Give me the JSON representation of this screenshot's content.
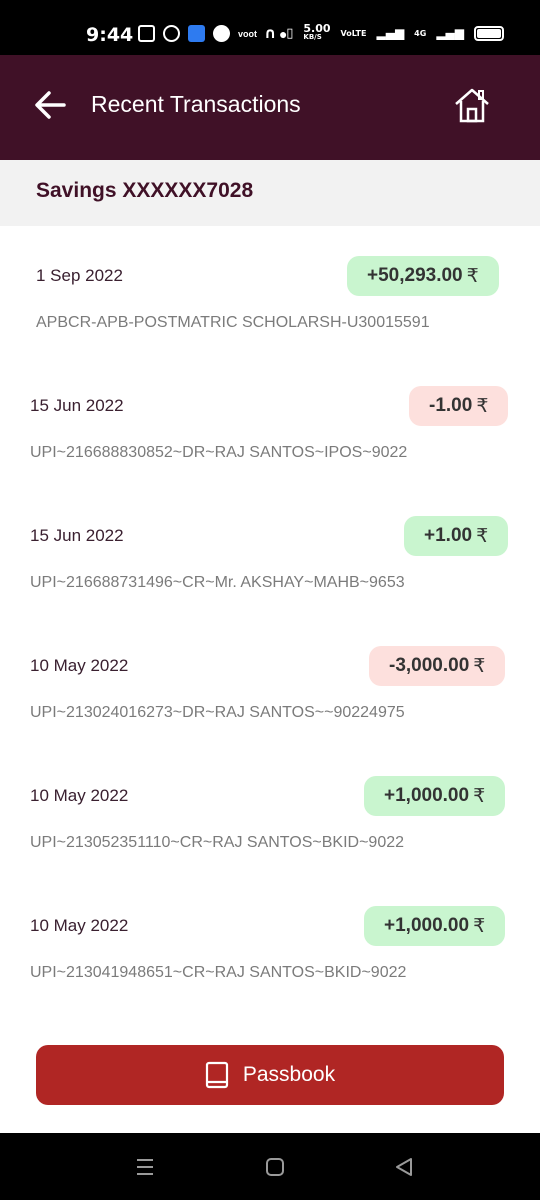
{
  "status_bar": {
    "time": "9:44",
    "speed": "5.00",
    "speed_unit": "KB/S",
    "volte": "VoLTE",
    "network": "4G"
  },
  "header": {
    "title": "Recent Transactions"
  },
  "account": {
    "label": "Savings XXXXXX7028"
  },
  "transactions": [
    {
      "date": "1 Sep 2022",
      "amount": "+50,293.00",
      "type": "credit",
      "description": "APBCR-APB-POSTMATRIC SCHOLARSH-U30015591"
    },
    {
      "date": "15 Jun 2022",
      "amount": "-1.00",
      "type": "debit",
      "description": "UPI~216688830852~DR~RAJ SANTOS~IPOS~9022"
    },
    {
      "date": "15 Jun 2022",
      "amount": "+1.00",
      "type": "credit",
      "description": "UPI~216688731496~CR~Mr. AKSHAY~MAHB~9653"
    },
    {
      "date": "10 May 2022",
      "amount": "-3,000.00",
      "type": "debit",
      "description": "UPI~213024016273~DR~RAJ SANTOS~~90224975"
    },
    {
      "date": "10 May 2022",
      "amount": "+1,000.00",
      "type": "credit",
      "description": "UPI~213052351110~CR~RAJ SANTOS~BKID~9022"
    },
    {
      "date": "10 May 2022",
      "amount": "+1,000.00",
      "type": "credit",
      "description": "UPI~213041948651~CR~RAJ SANTOS~BKID~9022"
    }
  ],
  "currency_symbol": "₹",
  "passbook": {
    "label": "Passbook"
  },
  "colors": {
    "header_bg": "#401127",
    "credit_bg": "#c9f5cf",
    "debit_bg": "#fde0dd",
    "button_bg": "#b02624"
  }
}
